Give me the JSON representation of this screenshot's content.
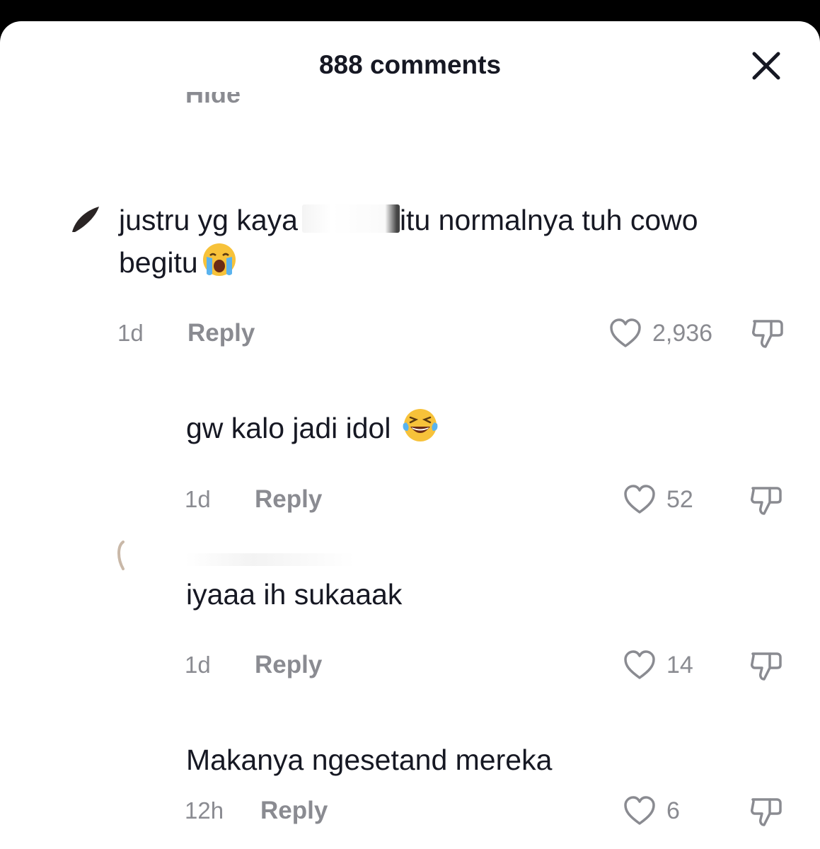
{
  "header": {
    "title": "888 comments"
  },
  "hidden_replies": {
    "label": "Hide"
  },
  "comments": [
    {
      "text_before": "justru yg kaya",
      "text_after": "itu normalnya tuh cowo",
      "text_line2": "begitu",
      "emoji": "crying-face-emoji",
      "time": "1d",
      "reply_label": "Reply",
      "likes": "2,936"
    },
    {
      "text": "gw kalo jadi idol",
      "emoji": "tears-of-joy-emoji",
      "time": "1d",
      "reply_label": "Reply",
      "likes": "52"
    },
    {
      "text": "iyaaa ih sukaaak",
      "time": "1d",
      "reply_label": "Reply",
      "likes": "14"
    },
    {
      "text": "Makanya ngesetand mereka",
      "time": "12h",
      "reply_label": "Reply",
      "likes": "6"
    }
  ],
  "colors": {
    "primary_text": "#161823",
    "secondary_text": "#8a8b91",
    "background": "#ffffff",
    "status_bar": "#000000"
  },
  "icons": {
    "close": "close-icon",
    "like": "heart-outline-icon",
    "dislike": "thumbs-down-icon"
  }
}
